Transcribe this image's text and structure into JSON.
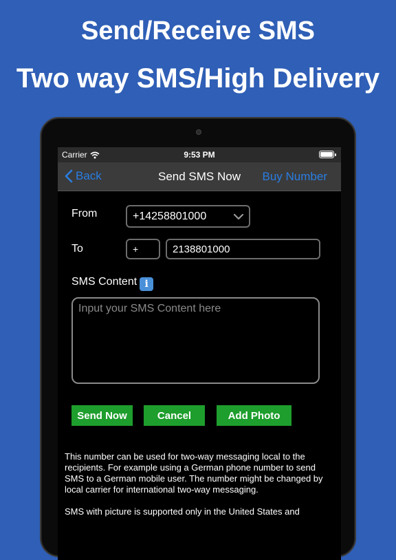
{
  "promo": {
    "line1": "Send/Receive SMS",
    "line2": "Two way SMS/High Delivery"
  },
  "status_bar": {
    "carrier": "Carrier",
    "time": "9:53 PM"
  },
  "nav": {
    "back_label": "Back",
    "title": "Send SMS Now",
    "buy_label": "Buy Number"
  },
  "form": {
    "from_label": "From",
    "from_value": "+14258801000",
    "to_label": "To",
    "country_code": "+",
    "to_number": "2138801000",
    "content_label": "SMS Content",
    "content_placeholder": "Input your SMS Content here"
  },
  "buttons": {
    "send": "Send Now",
    "cancel": "Cancel",
    "add_photo": "Add Photo"
  },
  "info": {
    "paragraph1": "This number can be used for two-way messaging local to the recipients. For example using a German phone number to send SMS to a German mobile user. The number might be changed by local carrier for international two-way messaging.",
    "paragraph2": "SMS with picture is supported only in the United States and"
  },
  "colors": {
    "background": "#2f5fb6",
    "accent_blue": "#2a7de1",
    "button_green": "#1e9e2d"
  },
  "icons": {
    "wifi": "wifi-icon",
    "battery": "battery-icon",
    "back": "chevron-left-icon",
    "dropdown": "chevron-down-icon",
    "info": "info-icon"
  }
}
